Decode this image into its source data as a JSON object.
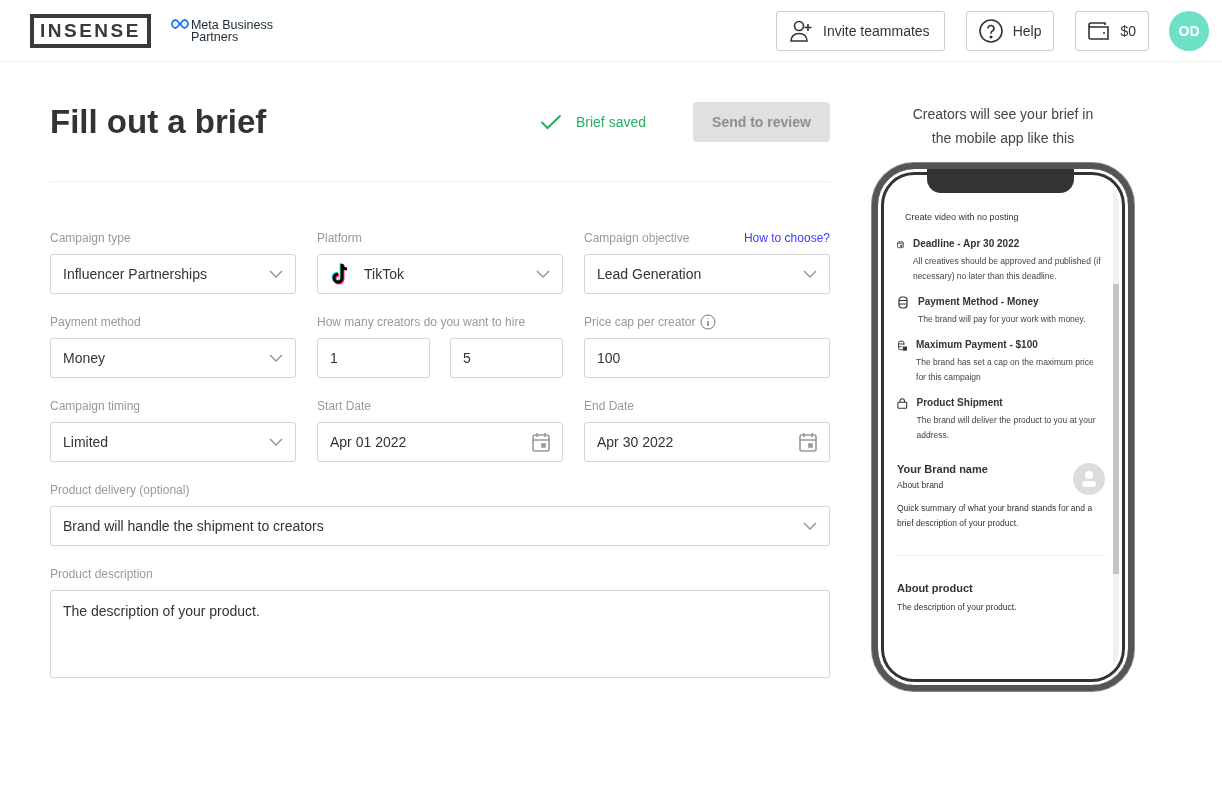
{
  "header": {
    "logo": "INSENSE",
    "partner": "Meta Business Partners",
    "buttons": [
      {
        "kind": "invite",
        "label": "Invite teammates"
      },
      {
        "kind": "help",
        "label": "Help"
      },
      {
        "kind": "wallet",
        "label": "$0"
      }
    ],
    "avatar": "OD"
  },
  "title": "Fill out a brief",
  "save_status": "Brief saved",
  "send_button": {
    "label": "Send to review",
    "disabled": true
  },
  "rows": [
    [
      {
        "kind": "select",
        "label": "Campaign type",
        "value": "Influencer Partnerships"
      },
      {
        "kind": "platform",
        "label": "Platform",
        "value": "TikTok"
      },
      {
        "kind": "select",
        "label": "Campaign objective",
        "value": "Lead Generation",
        "link": "How to choose?"
      }
    ],
    [
      {
        "kind": "select",
        "label": "Payment method",
        "value": "Money"
      },
      {
        "kind": "range",
        "label": "How many creators do you want to hire",
        "values": [
          "1",
          "5"
        ]
      },
      {
        "kind": "input",
        "label": "Price cap per creator",
        "value": "100",
        "info": true
      }
    ],
    [
      {
        "kind": "select",
        "label": "Campaign timing",
        "value": "Limited"
      },
      {
        "kind": "date",
        "label": "Start Date",
        "value": "Apr 01 2022"
      },
      {
        "kind": "date",
        "label": "End Date",
        "value": "Apr 30 2022"
      }
    ],
    [
      {
        "kind": "select",
        "label": "Product delivery (optional)",
        "value": "Brand will handle the shipment to creators"
      }
    ],
    [
      {
        "kind": "textarea",
        "label": "Product description",
        "value": "The description of your product."
      }
    ]
  ],
  "preview": {
    "caption": "Creators will see your brief in the mobile app like this",
    "intro": "Create video with no posting",
    "items": [
      {
        "kind": "calendar",
        "title": "Deadline - Apr 30 2022",
        "text": "All creatives should be approved and published (if necessary) no later than this deadline."
      },
      {
        "kind": "coins",
        "title": "Payment Method - Money",
        "text": "The brand will pay for your work with money."
      },
      {
        "kind": "coins-lock",
        "title": "Maximum Payment - $100",
        "text": "The brand has set a cap on the maximum price for this campaign"
      },
      {
        "kind": "bag",
        "title": "Product Shipment",
        "text": "The brand will deliver the product to you at your address."
      }
    ],
    "brand": {
      "name": "Your Brand name",
      "sub": "About brand",
      "text": "Quick summary of what your brand stands for and a brief description of your product."
    },
    "product": {
      "title": "About product",
      "text": "The description of your product."
    }
  }
}
